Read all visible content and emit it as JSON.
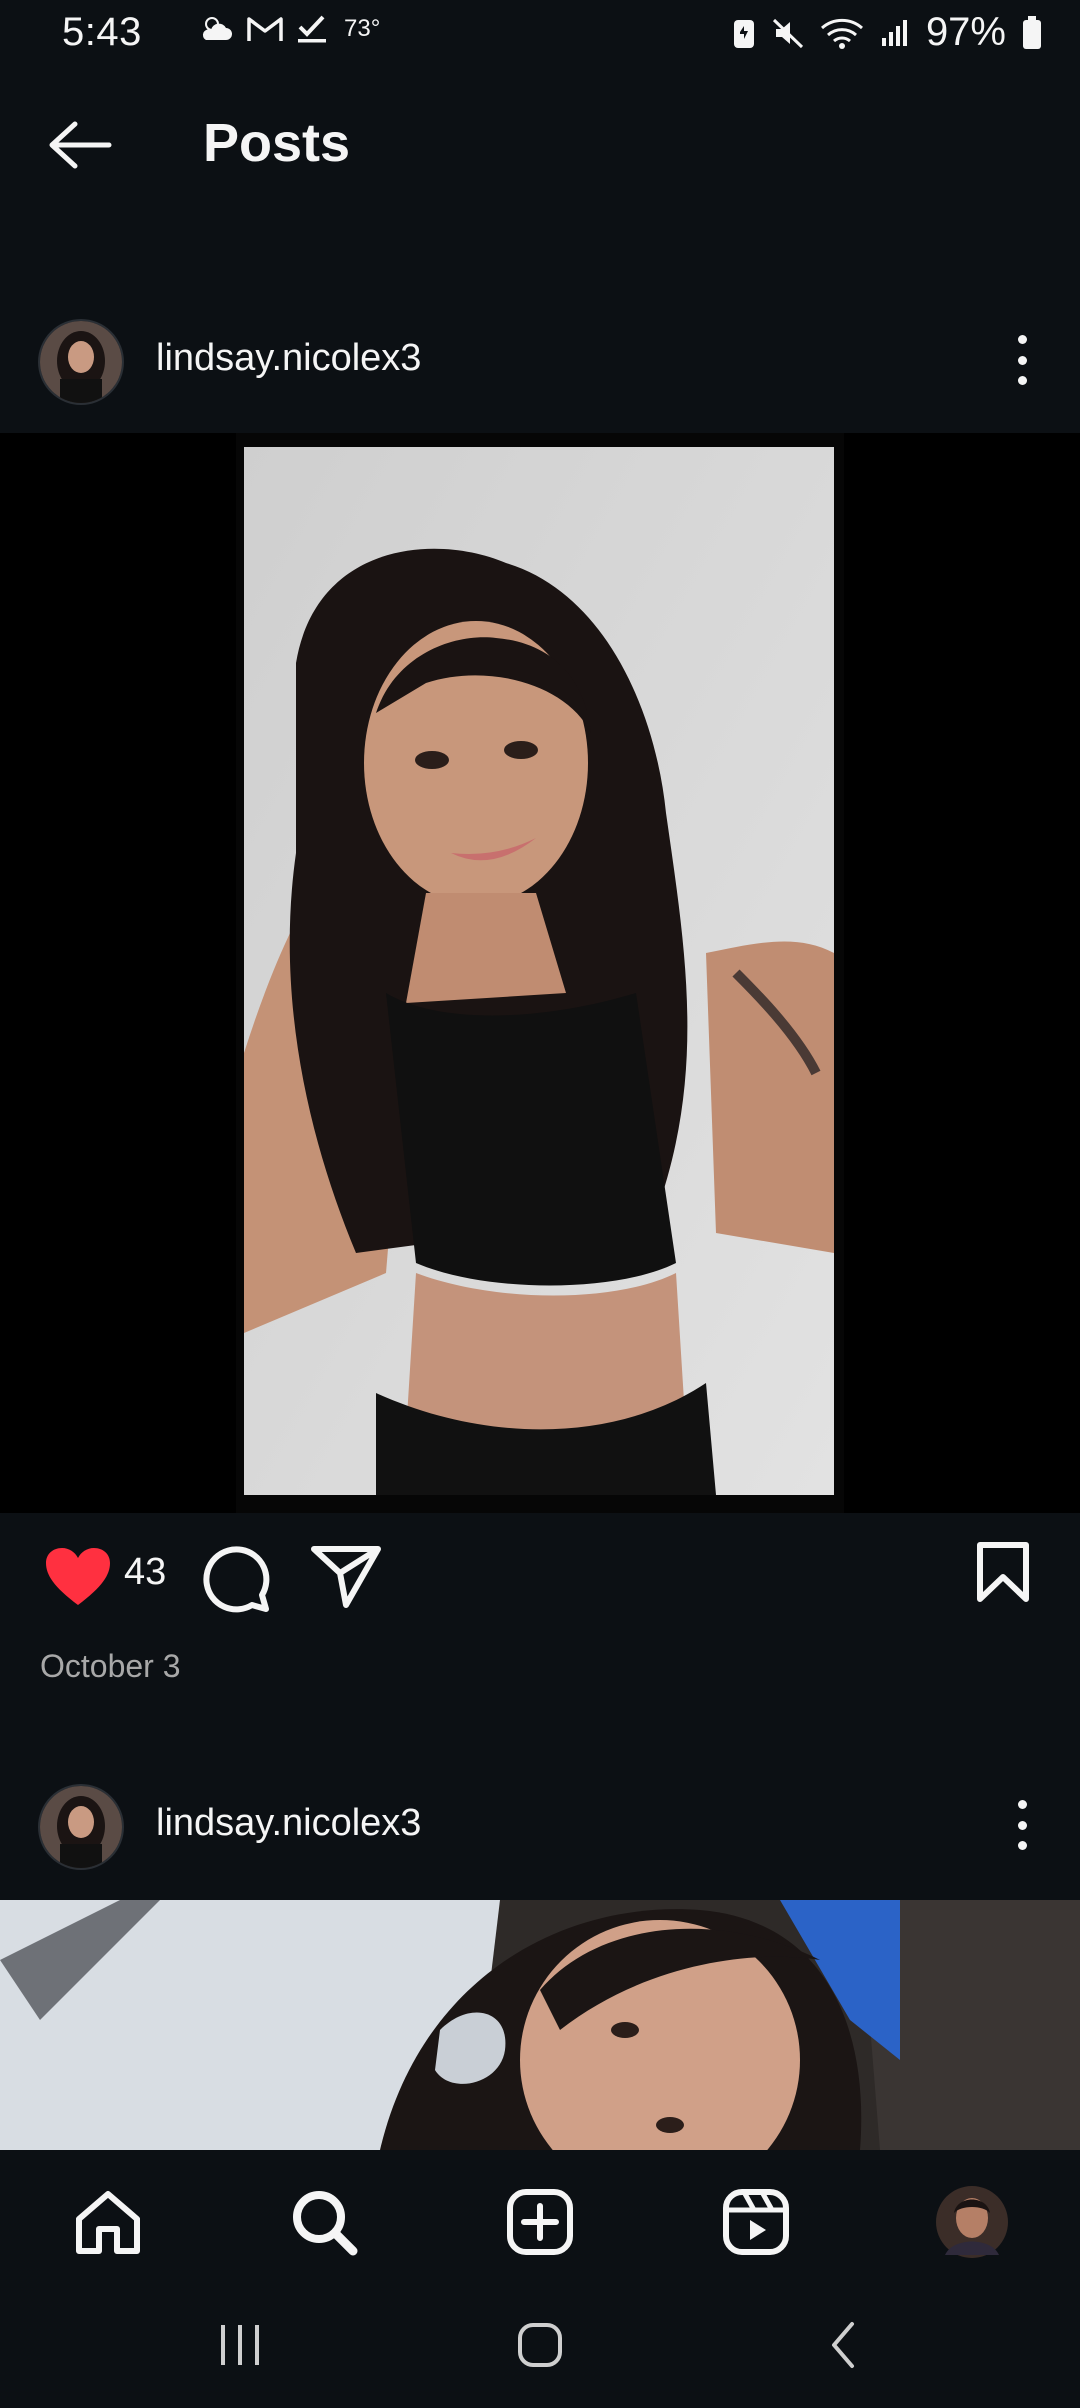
{
  "status_bar": {
    "time": "5:43",
    "temperature": "73°",
    "battery": "97%"
  },
  "header": {
    "title": "Posts"
  },
  "posts": [
    {
      "username": "lindsay.nicolex3",
      "likes": "43",
      "date": "October 3"
    },
    {
      "username": "lindsay.nicolex3"
    }
  ],
  "colors": {
    "background": "#0c1014",
    "like_red": "#ff3040",
    "secondary_text": "#a8a8a8"
  },
  "icons": {
    "back": "arrow-left-icon",
    "more": "vertical-dots-icon",
    "like": "heart-filled-icon",
    "comment": "speech-bubble-icon",
    "share": "paper-plane-icon",
    "save": "bookmark-icon",
    "nav": [
      "home-icon",
      "search-icon",
      "add-post-icon",
      "reels-icon",
      "profile-avatar"
    ],
    "system": [
      "recents-icon",
      "home-circle-icon",
      "back-chevron-icon"
    ]
  }
}
